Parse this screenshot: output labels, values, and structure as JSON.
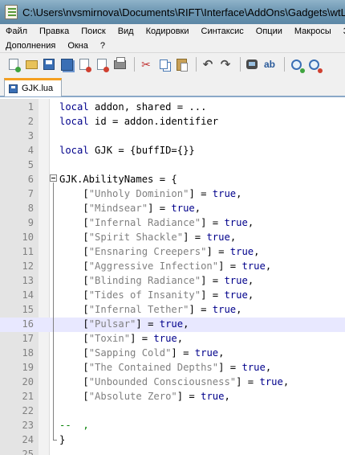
{
  "window": {
    "title": "C:\\Users\\nvsmirnova\\Documents\\RIFT\\Interface\\AddOns\\Gadgets\\wtLibUn..."
  },
  "menu": {
    "row1": [
      "Файл",
      "Правка",
      "Поиск",
      "Вид",
      "Кодировки",
      "Синтаксис",
      "Опции",
      "Макросы",
      "З"
    ],
    "row2": [
      "Дополнения",
      "Окна",
      "?"
    ]
  },
  "toolbar": {
    "buttons": [
      "new-file-icon",
      "open-file-icon",
      "save-icon",
      "save-all-icon",
      "close-file-icon",
      "close-all-icon",
      "print-icon",
      "cut-icon",
      "copy-icon",
      "paste-icon",
      "undo-icon",
      "redo-icon",
      "find-icon",
      "replace-icon",
      "zoom-in-icon",
      "zoom-out-icon"
    ]
  },
  "tabs": [
    {
      "label": "GJK.lua",
      "active": true
    }
  ],
  "editor": {
    "current_line": 16,
    "colors": {
      "keyword": "#00008b",
      "string": "#808080",
      "comment": "#008000",
      "current_line_bg": "#e8e8ff"
    },
    "lines": [
      {
        "n": "1",
        "tokens": [
          [
            "kw",
            "local"
          ],
          [
            "t",
            " addon, shared = ..."
          ]
        ]
      },
      {
        "n": "2",
        "tokens": [
          [
            "kw",
            "local"
          ],
          [
            "t",
            " id = addon.identifier"
          ]
        ]
      },
      {
        "n": "3",
        "tokens": []
      },
      {
        "n": "4",
        "tokens": [
          [
            "kw",
            "local"
          ],
          [
            "t",
            " GJK = {buffID={}}"
          ]
        ]
      },
      {
        "n": "5",
        "tokens": []
      },
      {
        "n": "6",
        "tokens": [
          [
            "t",
            "GJK.AbilityNames = {"
          ]
        ]
      },
      {
        "n": "7",
        "tokens": [
          [
            "t",
            "    ["
          ],
          [
            "str",
            "\"Unholy Dominion\""
          ],
          [
            "t",
            "] = "
          ],
          [
            "kw",
            "true"
          ],
          [
            "t",
            ","
          ]
        ]
      },
      {
        "n": "8",
        "tokens": [
          [
            "t",
            "    ["
          ],
          [
            "str",
            "\"Mindsear\""
          ],
          [
            "t",
            "] = "
          ],
          [
            "kw",
            "true"
          ],
          [
            "t",
            ","
          ]
        ]
      },
      {
        "n": "9",
        "tokens": [
          [
            "t",
            "    ["
          ],
          [
            "str",
            "\"Infernal Radiance\""
          ],
          [
            "t",
            "] = "
          ],
          [
            "kw",
            "true"
          ],
          [
            "t",
            ","
          ]
        ]
      },
      {
        "n": "10",
        "tokens": [
          [
            "t",
            "    ["
          ],
          [
            "str",
            "\"Spirit Shackle\""
          ],
          [
            "t",
            "] = "
          ],
          [
            "kw",
            "true"
          ],
          [
            "t",
            ","
          ]
        ]
      },
      {
        "n": "11",
        "tokens": [
          [
            "t",
            "    ["
          ],
          [
            "str",
            "\"Ensnaring Creepers\""
          ],
          [
            "t",
            "] = "
          ],
          [
            "kw",
            "true"
          ],
          [
            "t",
            ","
          ]
        ]
      },
      {
        "n": "12",
        "tokens": [
          [
            "t",
            "    ["
          ],
          [
            "str",
            "\"Aggressive Infection\""
          ],
          [
            "t",
            "] = "
          ],
          [
            "kw",
            "true"
          ],
          [
            "t",
            ","
          ]
        ]
      },
      {
        "n": "13",
        "tokens": [
          [
            "t",
            "    ["
          ],
          [
            "str",
            "\"Blinding Radiance\""
          ],
          [
            "t",
            "] = "
          ],
          [
            "kw",
            "true"
          ],
          [
            "t",
            ","
          ]
        ]
      },
      {
        "n": "14",
        "tokens": [
          [
            "t",
            "    ["
          ],
          [
            "str",
            "\"Tides of Insanity\""
          ],
          [
            "t",
            "] = "
          ],
          [
            "kw",
            "true"
          ],
          [
            "t",
            ","
          ]
        ]
      },
      {
        "n": "15",
        "tokens": [
          [
            "t",
            "    ["
          ],
          [
            "str",
            "\"Infernal Tether\""
          ],
          [
            "t",
            "] = "
          ],
          [
            "kw",
            "true"
          ],
          [
            "t",
            ","
          ]
        ]
      },
      {
        "n": "16",
        "tokens": [
          [
            "t",
            "    ["
          ],
          [
            "str",
            "\"Pulsar\""
          ],
          [
            "t",
            "] = "
          ],
          [
            "kw",
            "true"
          ],
          [
            "t",
            ","
          ]
        ]
      },
      {
        "n": "17",
        "tokens": [
          [
            "t",
            "    ["
          ],
          [
            "str",
            "\"Toxin\""
          ],
          [
            "t",
            "] = "
          ],
          [
            "kw",
            "true"
          ],
          [
            "t",
            ","
          ]
        ]
      },
      {
        "n": "18",
        "tokens": [
          [
            "t",
            "    ["
          ],
          [
            "str",
            "\"Sapping Cold\""
          ],
          [
            "t",
            "] = "
          ],
          [
            "kw",
            "true"
          ],
          [
            "t",
            ","
          ]
        ]
      },
      {
        "n": "19",
        "tokens": [
          [
            "t",
            "    ["
          ],
          [
            "str",
            "\"The Contained Depths\""
          ],
          [
            "t",
            "] = "
          ],
          [
            "kw",
            "true"
          ],
          [
            "t",
            ","
          ]
        ]
      },
      {
        "n": "20",
        "tokens": [
          [
            "t",
            "    ["
          ],
          [
            "str",
            "\"Unbounded Consciousness\""
          ],
          [
            "t",
            "] = "
          ],
          [
            "kw",
            "true"
          ],
          [
            "t",
            ","
          ]
        ]
      },
      {
        "n": "21",
        "tokens": [
          [
            "t",
            "    ["
          ],
          [
            "str",
            "\"Absolute Zero\""
          ],
          [
            "t",
            "] = "
          ],
          [
            "kw",
            "true"
          ],
          [
            "t",
            ","
          ]
        ]
      },
      {
        "n": "22",
        "tokens": []
      },
      {
        "n": "23",
        "tokens": [
          [
            "cmt",
            "--  ,"
          ]
        ]
      },
      {
        "n": "24",
        "tokens": [
          [
            "t",
            "}"
          ]
        ]
      },
      {
        "n": "25",
        "tokens": []
      }
    ]
  }
}
